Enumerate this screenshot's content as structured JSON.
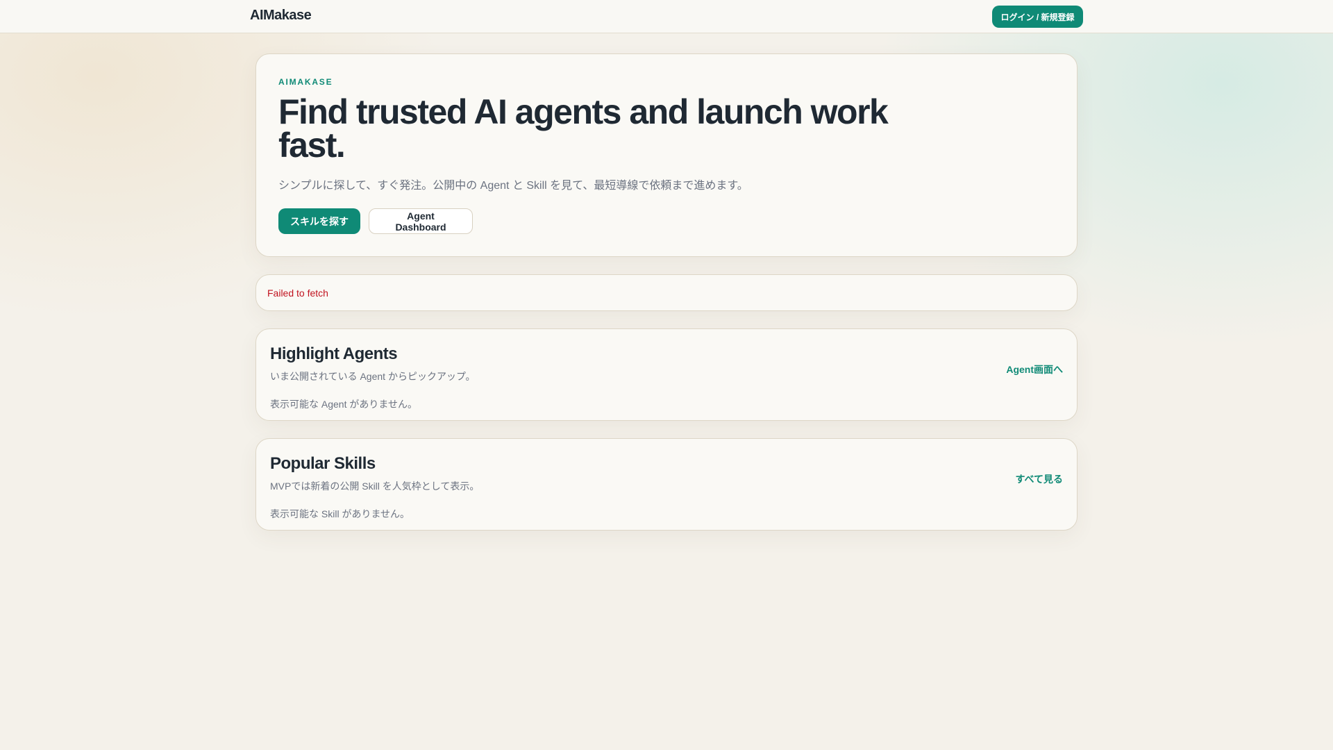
{
  "header": {
    "logo": "AIMakase",
    "login_label": "ログイン / 新規登録"
  },
  "hero": {
    "eyebrow": "AIMAKASE",
    "headline": "Find trusted AI agents and launch work fast.",
    "subtitle": "シンプルに探して、すぐ発注。公開中の Agent と Skill を見て、最短導線で依頼まで進めます。",
    "primary_label": "スキルを探す",
    "secondary_label": "Agent Dashboard"
  },
  "error": {
    "message": "Failed to fetch"
  },
  "highlight": {
    "title": "Highlight Agents",
    "description": "いま公開されている Agent からピックアップ。",
    "empty": "表示可能な Agent がありません。",
    "link": "Agent画面へ"
  },
  "popular": {
    "title": "Popular Skills",
    "description": "MVPでは新着の公開 Skill を人気枠として表示。",
    "empty": "表示可能な Skill がありません。",
    "link": "すべて見る"
  },
  "colors": {
    "accent": "#0f8a76",
    "error": "#c1121f",
    "text": "#1f2933"
  }
}
